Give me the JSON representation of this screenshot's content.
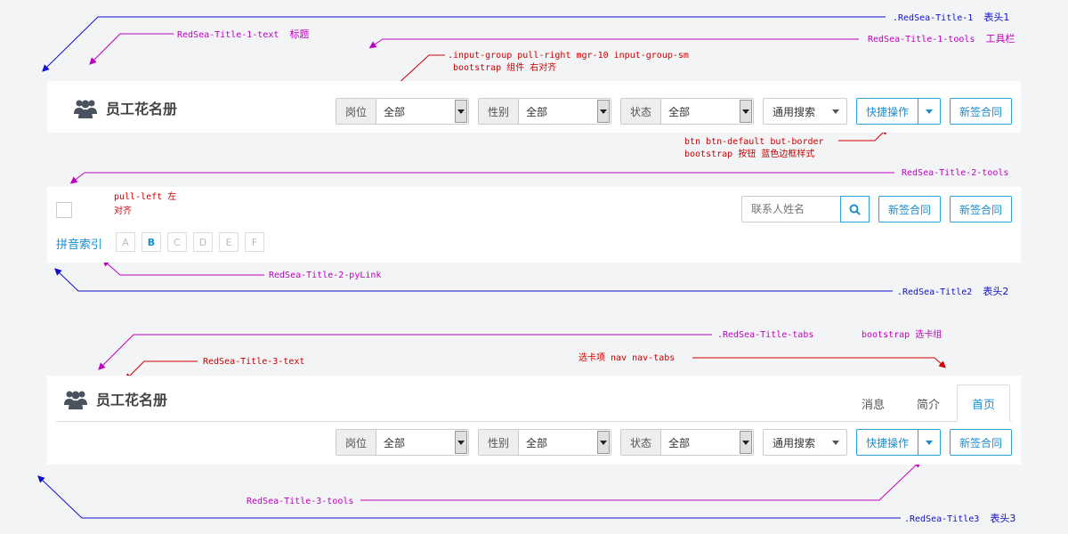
{
  "colors": {
    "accent": "#1a8fd0",
    "annotation_blue": "#1010cc",
    "annotation_magenta": "#c000c0",
    "annotation_red": "#cc0000"
  },
  "annotations": {
    "title1_class": ".RedSea-Title-1",
    "title1_cn": "表头1",
    "title1_text_class": "RedSea-Title-1-text",
    "title1_text_cn": "标题",
    "title1_tools_class": "RedSea-Title-1-tools",
    "title1_tools_cn": "工具栏",
    "input_group_class": ".input-group  pull-right   mgr-10   input-group-sm",
    "input_group_desc": "bootstrap 组件  右对齐",
    "btn_class": "btn  btn-default  but-border",
    "btn_desc": "bootstrap 按钮  蓝色边框样式",
    "title2_tools_class": "RedSea-Title-2-tools",
    "pull_left_label": "pull-left  左",
    "pull_left_label2": "对齐",
    "title2_pylink_class": "RedSea-Title-2-pyLink",
    "title2_class": ".RedSea-Title2",
    "title2_cn": "表头2",
    "title_tabs_class": ".RedSea-Title-tabs",
    "title_tabs_desc": "bootstrap 选卡组",
    "title3_text_class": "RedSea-Title-3-text",
    "nav_tabs_label": "选卡项  nav nav-tabs",
    "title3_tools_class": "RedSea-Title-3-tools",
    "title3_class": ".RedSea-Title3",
    "title3_cn": "表头3"
  },
  "header1": {
    "title": "员工花名册",
    "icon": "people-icon",
    "filters": [
      {
        "label": "岗位",
        "value": "全部"
      },
      {
        "label": "性别",
        "value": "全部"
      },
      {
        "label": "状态",
        "value": "全部"
      }
    ],
    "search_label": "通用搜索",
    "quick_action_label": "快捷操作",
    "new_contract_label": "新签合同"
  },
  "header2": {
    "search_placeholder": "联系人姓名",
    "search_icon": "search-icon",
    "new_contract_label_1": "新签合同",
    "new_contract_label_2": "新签合同",
    "pinyin_label": "拼音索引",
    "letters": [
      "A",
      "B",
      "C",
      "D",
      "E",
      "F"
    ],
    "active_letter": "B"
  },
  "header3": {
    "title": "员工花名册",
    "icon": "people-icon",
    "tabs": [
      "消息",
      "简介",
      "首页"
    ],
    "active_tab": "首页",
    "filters": [
      {
        "label": "岗位",
        "value": "全部"
      },
      {
        "label": "性别",
        "value": "全部"
      },
      {
        "label": "状态",
        "value": "全部"
      }
    ],
    "search_label": "通用搜索",
    "quick_action_label": "快捷操作",
    "new_contract_label": "新签合同"
  }
}
